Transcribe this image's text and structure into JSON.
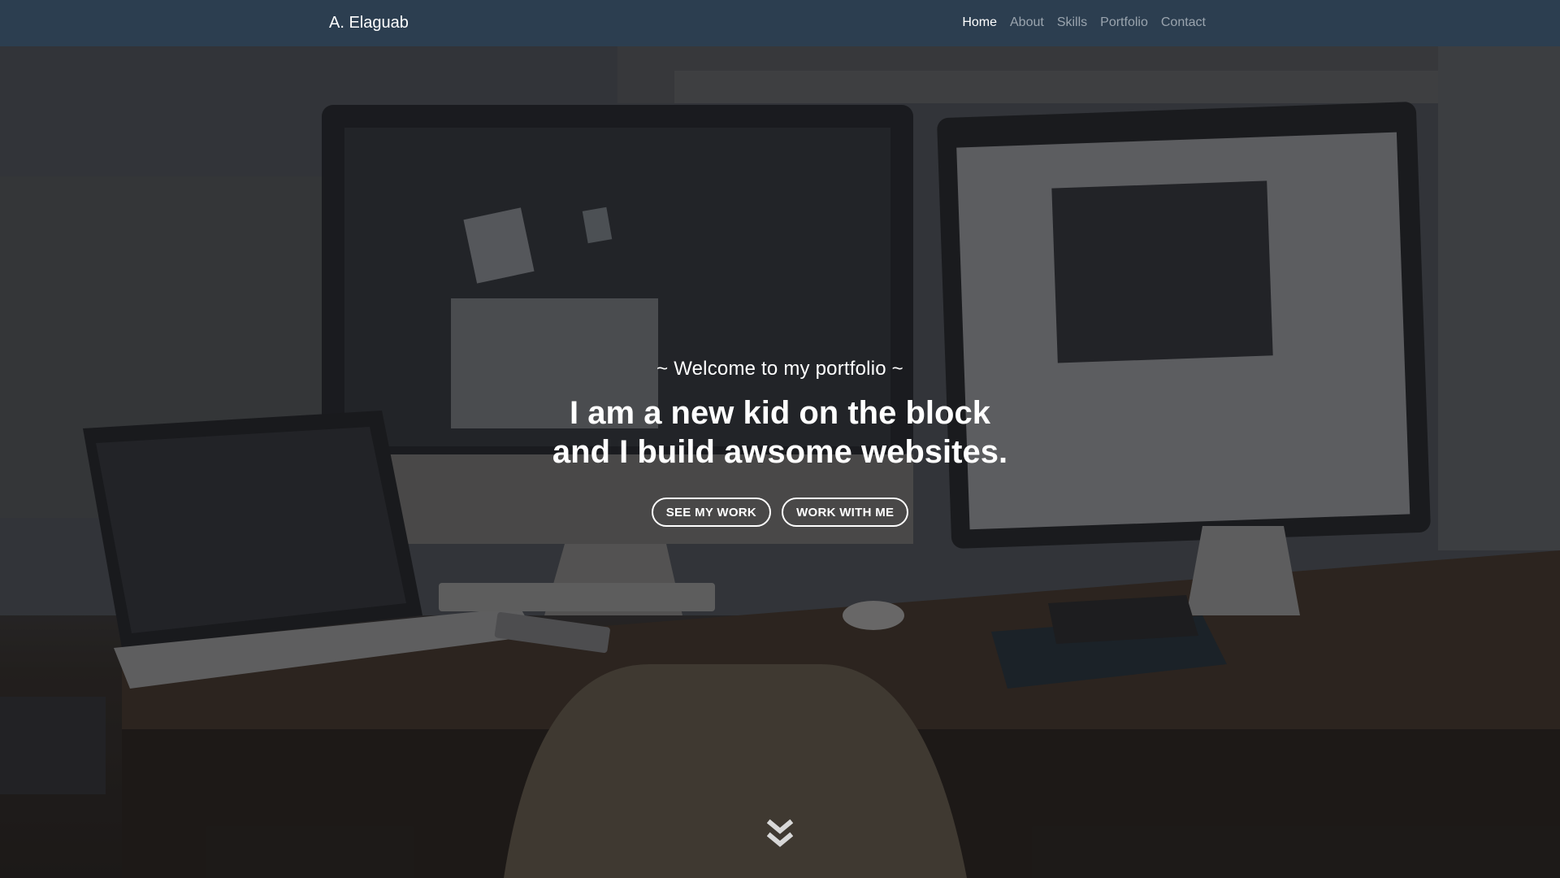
{
  "navbar": {
    "brand": "A. Elaguab",
    "links": [
      {
        "label": "Home",
        "active": true
      },
      {
        "label": "About",
        "active": false
      },
      {
        "label": "Skills",
        "active": false
      },
      {
        "label": "Portfolio",
        "active": false
      },
      {
        "label": "Contact",
        "active": false
      }
    ]
  },
  "hero": {
    "subtitle": "~ Welcome to my portfolio ~",
    "headline_line1": "I am a new kid on the block",
    "headline_line2": "and I build awsome websites.",
    "buttons": {
      "see_work": "SEE MY WORK",
      "work_with_me": "WORK WITH ME"
    },
    "scroll_icon": "double-chevron-down-icon"
  },
  "colors": {
    "navbar_bg": "#2c3e50",
    "nav_active": "#ffffff",
    "nav_inactive": "#9aa4ae",
    "hero_text": "#ffffff"
  }
}
